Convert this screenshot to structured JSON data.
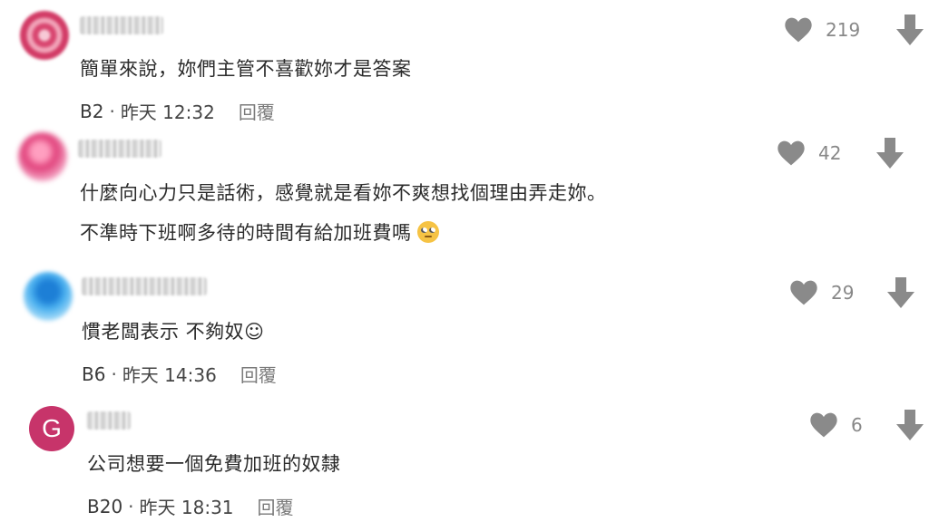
{
  "comments": [
    {
      "text_lines": [
        "簡單來說，妳們主管不喜歡妳才是答案"
      ],
      "floor": "B2",
      "dot": "·",
      "time": "昨天 12:32",
      "reply": "回覆",
      "likes": "219"
    },
    {
      "text_lines": [
        "什麼向心力只是話術，感覺就是看妳不爽想找個理由弄走妳。",
        "不準時下班啊多待的時間有給加班費嗎"
      ],
      "likes": "42"
    },
    {
      "text_lines": [
        "慣老闆表示 不夠奴☺"
      ],
      "floor": "B6",
      "dot": "·",
      "time": "昨天 14:36",
      "reply": "回覆",
      "likes": "29"
    },
    {
      "avatar_letter": "G",
      "text_lines": [
        "公司想要一個免費加班的奴隸"
      ],
      "floor": "B20",
      "dot": "·",
      "time": "昨天 18:31",
      "reply": "回覆",
      "likes": "6"
    }
  ],
  "icons": {
    "like": "heart-icon",
    "downvote": "down-arrow-icon",
    "emoji": "eye-roll-emoji-icon"
  },
  "colors": {
    "icon_gray": "#8a8a8a",
    "letter_avatar_bg": "#c7346a"
  }
}
